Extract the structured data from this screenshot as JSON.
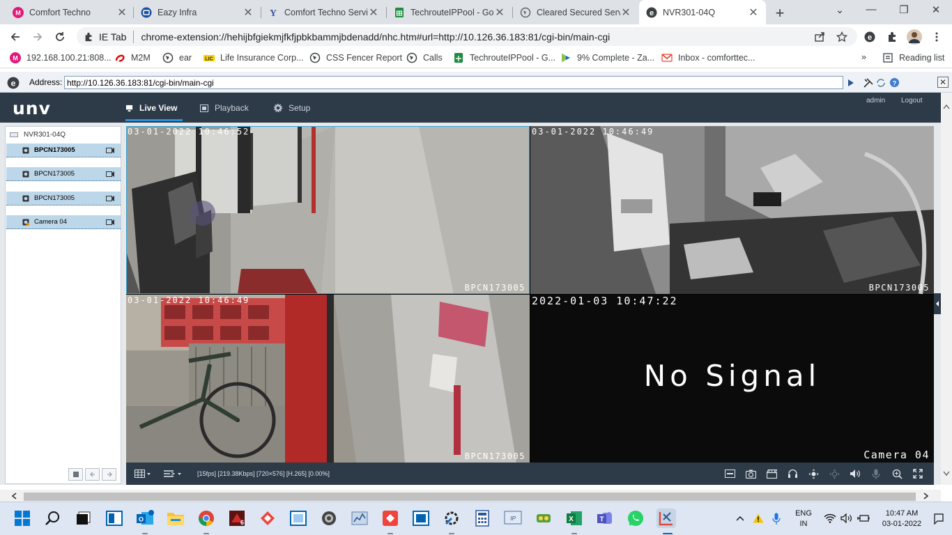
{
  "tabs": [
    {
      "title": "Comfort Techno",
      "active": false
    },
    {
      "title": "Eazy Infra",
      "active": false
    },
    {
      "title": "Comfort Techno Servic",
      "active": false
    },
    {
      "title": "TechrouteIPPool - Goo",
      "active": false
    },
    {
      "title": "Cleared Secured Servic",
      "active": false
    },
    {
      "title": "NVR301-04Q",
      "active": true
    }
  ],
  "window_controls": {
    "minimize": "—",
    "restore": "❐",
    "close": "✕",
    "dropdown": "⌄"
  },
  "omnibox": {
    "ie_tab_label": "IE Tab",
    "url": "chrome-extension://hehijbfgiekmjfkfjpbkbammjbdenadd/nhc.htm#url=http://10.126.36.183:81/cgi-bin/main-cgi"
  },
  "bookmarks": [
    {
      "label": "192.168.100.21:808...",
      "icon": "magenta-m-icon"
    },
    {
      "label": "M2M",
      "icon": "airtel-icon"
    },
    {
      "label": "ear",
      "icon": "globe-icon"
    },
    {
      "label": "Life Insurance Corp...",
      "icon": "lic-icon"
    },
    {
      "label": "CSS Fencer Report",
      "icon": "globe-icon"
    },
    {
      "label": "Calls",
      "icon": "globe-icon"
    },
    {
      "label": "TechrouteIPPool - G...",
      "icon": "sheets-icon"
    },
    {
      "label": "9% Complete - Za...",
      "icon": "zoho-icon"
    },
    {
      "label": "Inbox - comforttec...",
      "icon": "gmail-icon"
    }
  ],
  "reading_list_label": "Reading list",
  "ie_address": {
    "label": "Address:",
    "value": "http://10.126.36.183:81/cgi-bin/main-cgi"
  },
  "nvr": {
    "logo": "unv",
    "nav": [
      {
        "label": "Live View",
        "active": true,
        "icon": "monitor-icon"
      },
      {
        "label": "Playback",
        "active": false,
        "icon": "film-icon"
      },
      {
        "label": "Setup",
        "active": false,
        "icon": "gear-icon"
      }
    ],
    "user": "admin",
    "logout": "Logout",
    "device": "NVR301-04Q",
    "cameras": [
      {
        "name": "BPCN173005",
        "selected": true
      },
      {
        "name": "BPCN173005",
        "selected": false
      },
      {
        "name": "BPCN173005",
        "selected": false
      },
      {
        "name": "Camera 04",
        "selected": false
      }
    ],
    "tiles": [
      {
        "timestamp": "03-01-2022 10:46:52",
        "name": "BPCN173005"
      },
      {
        "timestamp": "03-01-2022 10:46:49",
        "name": "BPCN173005"
      },
      {
        "timestamp": "03-01-2022 10:46:49",
        "name": "BPCN173005"
      },
      {
        "timestamp": "2022-01-03 10:47:22",
        "name": "Camera 04",
        "no_signal": "No Signal"
      }
    ],
    "stream_stats": "[15fps] [219.38Kbps] [720×576] [H.265] [0.00%]"
  },
  "taskbar": {
    "lang": "ENG",
    "region": "IN",
    "time": "10:47 AM",
    "date": "03-01-2022"
  },
  "colors": {
    "nvr_header": "#2d3a47",
    "accent": "#2d8fd8",
    "camera_row": "#bdd7ea"
  }
}
